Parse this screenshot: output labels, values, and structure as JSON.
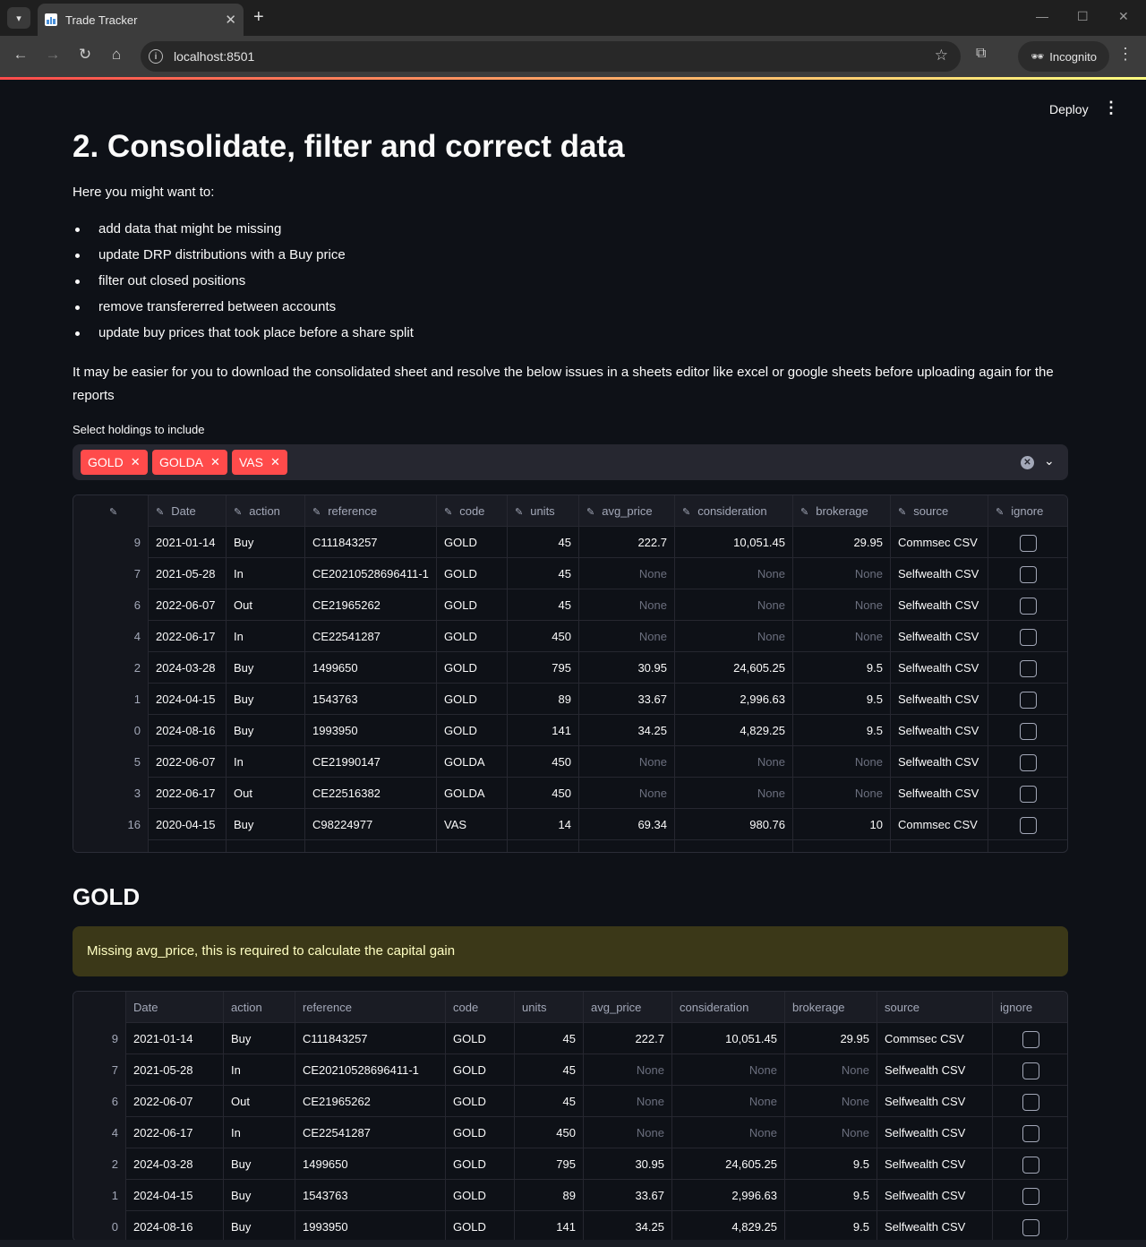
{
  "browser": {
    "tab_title": "Trade Tracker",
    "url": "localhost:8501",
    "incognito_label": "Incognito"
  },
  "streamlit": {
    "deploy_label": "Deploy"
  },
  "page": {
    "title": "2. Consolidate, filter and correct data",
    "intro": "Here you might want to:",
    "bullets": [
      "add data that might be missing",
      "update DRP distributions with a Buy price",
      "filter out closed positions",
      "remove transfererred between accounts",
      "update buy prices that took place before a share split"
    ],
    "paragraph": "It may be easier for you to download the consolidated sheet and resolve the below issues in a sheets editor like excel or google sheets before uploading again for the reports",
    "multiselect": {
      "label": "Select holdings to include",
      "selected": [
        "GOLD",
        "GOLDA",
        "VAS"
      ]
    }
  },
  "table": {
    "columns": [
      "Date",
      "action",
      "reference",
      "code",
      "units",
      "avg_price",
      "consideration",
      "brokerage",
      "source",
      "ignore"
    ],
    "rows": [
      [
        "9",
        "2021-01-14",
        "Buy",
        "C111843257",
        "GOLD",
        "45",
        "222.7",
        "10,051.45",
        "29.95",
        "Commsec CSV"
      ],
      [
        "7",
        "2021-05-28",
        "In",
        "CE20210528696411-1",
        "GOLD",
        "45",
        "None",
        "None",
        "None",
        "Selfwealth CSV"
      ],
      [
        "6",
        "2022-06-07",
        "Out",
        "CE21965262",
        "GOLD",
        "45",
        "None",
        "None",
        "None",
        "Selfwealth CSV"
      ],
      [
        "4",
        "2022-06-17",
        "In",
        "CE22541287",
        "GOLD",
        "450",
        "None",
        "None",
        "None",
        "Selfwealth CSV"
      ],
      [
        "2",
        "2024-03-28",
        "Buy",
        "1499650",
        "GOLD",
        "795",
        "30.95",
        "24,605.25",
        "9.5",
        "Selfwealth CSV"
      ],
      [
        "1",
        "2024-04-15",
        "Buy",
        "1543763",
        "GOLD",
        "89",
        "33.67",
        "2,996.63",
        "9.5",
        "Selfwealth CSV"
      ],
      [
        "0",
        "2024-08-16",
        "Buy",
        "1993950",
        "GOLD",
        "141",
        "34.25",
        "4,829.25",
        "9.5",
        "Selfwealth CSV"
      ],
      [
        "5",
        "2022-06-07",
        "In",
        "CE21990147",
        "GOLDA",
        "450",
        "None",
        "None",
        "None",
        "Selfwealth CSV"
      ],
      [
        "3",
        "2022-06-17",
        "Out",
        "CE22516382",
        "GOLDA",
        "450",
        "None",
        "None",
        "None",
        "Selfwealth CSV"
      ],
      [
        "16",
        "2020-04-15",
        "Buy",
        "C98224977",
        "VAS",
        "14",
        "69.34",
        "980.76",
        "10",
        "Commsec CSV"
      ]
    ]
  },
  "gold_section": {
    "heading": "GOLD",
    "warning": "Missing avg_price, this is required to calculate the capital gain",
    "columns": [
      "Date",
      "action",
      "reference",
      "code",
      "units",
      "avg_price",
      "consideration",
      "brokerage",
      "source",
      "ignore"
    ],
    "rows": [
      [
        "9",
        "2021-01-14",
        "Buy",
        "C111843257",
        "GOLD",
        "45",
        "222.7",
        "10,051.45",
        "29.95",
        "Commsec CSV"
      ],
      [
        "7",
        "2021-05-28",
        "In",
        "CE20210528696411-1",
        "GOLD",
        "45",
        "None",
        "None",
        "None",
        "Selfwealth CSV"
      ],
      [
        "6",
        "2022-06-07",
        "Out",
        "CE21965262",
        "GOLD",
        "45",
        "None",
        "None",
        "None",
        "Selfwealth CSV"
      ],
      [
        "4",
        "2022-06-17",
        "In",
        "CE22541287",
        "GOLD",
        "450",
        "None",
        "None",
        "None",
        "Selfwealth CSV"
      ],
      [
        "2",
        "2024-03-28",
        "Buy",
        "1499650",
        "GOLD",
        "795",
        "30.95",
        "24,605.25",
        "9.5",
        "Selfwealth CSV"
      ],
      [
        "1",
        "2024-04-15",
        "Buy",
        "1543763",
        "GOLD",
        "89",
        "33.67",
        "2,996.63",
        "9.5",
        "Selfwealth CSV"
      ],
      [
        "0",
        "2024-08-16",
        "Buy",
        "1993950",
        "GOLD",
        "141",
        "34.25",
        "4,829.25",
        "9.5",
        "Selfwealth CSV"
      ]
    ]
  },
  "colors": {
    "background": "#0e1117",
    "accent": "#ff4b4b",
    "warning_bg": "#3b3818",
    "warning_text": "#ffffc2"
  }
}
